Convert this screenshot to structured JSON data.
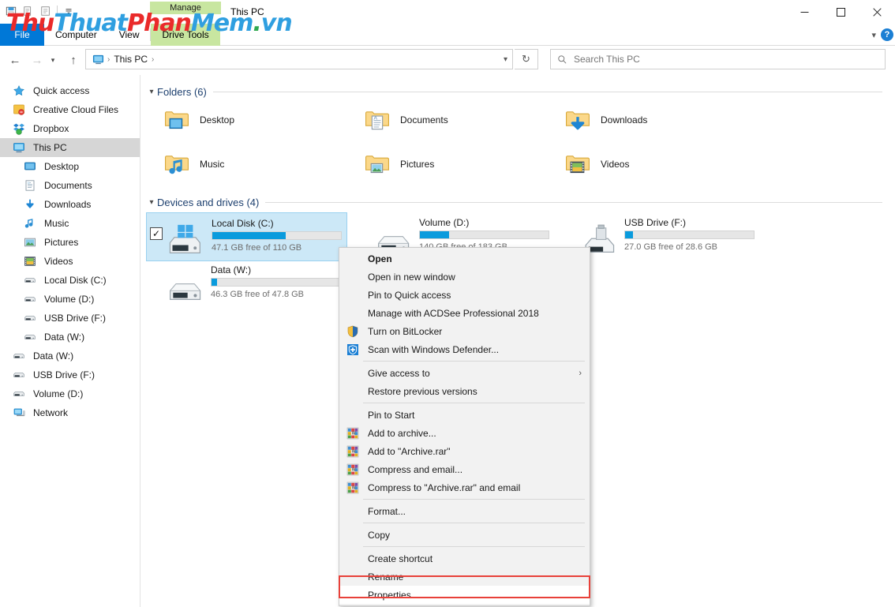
{
  "window": {
    "title": "This PC",
    "minimize_icon": "minimize-icon",
    "maximize_icon": "maximize-icon",
    "close_icon": "close-icon",
    "quick_access_icons": [
      "save-icon",
      "new-folder-icon",
      "properties-icon",
      "customize-icon"
    ]
  },
  "ribbon": {
    "contextual_group": "Manage",
    "tabs": [
      {
        "label": "File",
        "id": "file"
      },
      {
        "label": "Computer",
        "id": "computer"
      },
      {
        "label": "View",
        "id": "view"
      },
      {
        "label": "Drive Tools",
        "id": "drive-tools"
      }
    ],
    "collapse_icon": "chevron-down-icon",
    "help_label": "?"
  },
  "navigation": {
    "back_icon": "arrow-left-icon",
    "forward_icon": "arrow-right-icon",
    "recent_icon": "chevron-down-icon",
    "up_icon": "arrow-up-icon",
    "breadcrumb_icon": "this-pc-icon",
    "breadcrumb": [
      "This PC"
    ],
    "breadcrumb_dropdown_icon": "chevron-down-icon",
    "refresh_icon": "refresh-icon",
    "refresh_label": "↻"
  },
  "search": {
    "icon": "search-icon",
    "placeholder": "Search This PC",
    "value": ""
  },
  "sidebar": {
    "items": [
      {
        "label": "Quick access",
        "icon": "star-icon",
        "level": 0,
        "selected": false
      },
      {
        "label": "Creative Cloud Files",
        "icon": "creative-cloud-icon",
        "level": 0,
        "selected": false
      },
      {
        "label": "Dropbox",
        "icon": "dropbox-icon",
        "level": 0,
        "selected": false
      },
      {
        "label": "This PC",
        "icon": "this-pc-icon",
        "level": 0,
        "selected": true
      },
      {
        "label": "Desktop",
        "icon": "desktop-icon",
        "level": 1,
        "selected": false
      },
      {
        "label": "Documents",
        "icon": "documents-icon",
        "level": 1,
        "selected": false
      },
      {
        "label": "Downloads",
        "icon": "downloads-icon",
        "level": 1,
        "selected": false
      },
      {
        "label": "Music",
        "icon": "music-icon",
        "level": 1,
        "selected": false
      },
      {
        "label": "Pictures",
        "icon": "pictures-icon",
        "level": 1,
        "selected": false
      },
      {
        "label": "Videos",
        "icon": "videos-icon",
        "level": 1,
        "selected": false
      },
      {
        "label": "Local Disk (C:)",
        "icon": "drive-icon",
        "level": 1,
        "selected": false
      },
      {
        "label": "Volume (D:)",
        "icon": "drive-icon",
        "level": 1,
        "selected": false
      },
      {
        "label": "USB Drive (F:)",
        "icon": "drive-icon",
        "level": 1,
        "selected": false
      },
      {
        "label": "Data (W:)",
        "icon": "drive-icon",
        "level": 1,
        "selected": false
      },
      {
        "label": "Data (W:)",
        "icon": "drive-icon",
        "level": 0,
        "selected": false
      },
      {
        "label": "USB Drive (F:)",
        "icon": "drive-icon",
        "level": 0,
        "selected": false
      },
      {
        "label": "Volume (D:)",
        "icon": "drive-icon",
        "level": 0,
        "selected": false
      },
      {
        "label": "Network",
        "icon": "network-icon",
        "level": 0,
        "selected": false
      }
    ]
  },
  "main": {
    "folders_group": {
      "title": "Folders (6)",
      "collapse_icon": "chevron-down-icon",
      "items": [
        {
          "label": "Desktop",
          "icon": "folder-desktop-icon"
        },
        {
          "label": "Documents",
          "icon": "folder-documents-icon"
        },
        {
          "label": "Downloads",
          "icon": "folder-downloads-icon"
        },
        {
          "label": "Music",
          "icon": "folder-music-icon"
        },
        {
          "label": "Pictures",
          "icon": "folder-pictures-icon"
        },
        {
          "label": "Videos",
          "icon": "folder-videos-icon"
        }
      ]
    },
    "drives_group": {
      "title": "Devices and drives (4)",
      "collapse_icon": "chevron-down-icon",
      "items": [
        {
          "name": "Local Disk (C:)",
          "free_text": "47.1 GB free of 110 GB",
          "free_gb": 47.1,
          "total_gb": 110,
          "used_percent": 57,
          "icon": "windows-drive-icon",
          "selected": true,
          "checked": true
        },
        {
          "name": "Volume (D:)",
          "free_text": "140 GB free of 183 GB",
          "free_gb": 140,
          "total_gb": 183,
          "used_percent": 23,
          "icon": "drive-icon",
          "selected": false,
          "checked": false
        },
        {
          "name": "USB Drive (F:)",
          "free_text": "27.0 GB free of 28.6 GB",
          "free_gb": 27.0,
          "total_gb": 28.6,
          "used_percent": 6,
          "icon": "usb-drive-icon",
          "selected": false,
          "checked": false
        },
        {
          "name": "Data (W:)",
          "free_text": "46.3 GB free of 47.8 GB",
          "free_gb": 46.3,
          "total_gb": 47.8,
          "used_percent": 4,
          "icon": "drive-icon",
          "selected": false,
          "checked": false
        }
      ]
    }
  },
  "context_menu": {
    "items": [
      {
        "label": "Open",
        "type": "item",
        "bold": true,
        "icon": null
      },
      {
        "label": "Open in new window",
        "type": "item",
        "icon": null
      },
      {
        "label": "Pin to Quick access",
        "type": "item",
        "icon": null
      },
      {
        "label": "Manage with ACDSee Professional 2018",
        "type": "item",
        "icon": null
      },
      {
        "label": "Turn on BitLocker",
        "type": "item",
        "icon": "bitlocker-shield-icon"
      },
      {
        "label": "Scan with Windows Defender...",
        "type": "item",
        "icon": "defender-shield-icon"
      },
      {
        "type": "separator"
      },
      {
        "label": "Give access to",
        "type": "submenu",
        "icon": null,
        "arrow": "›"
      },
      {
        "label": "Restore previous versions",
        "type": "item",
        "icon": null
      },
      {
        "type": "separator"
      },
      {
        "label": "Pin to Start",
        "type": "item",
        "icon": null
      },
      {
        "label": "Add to archive...",
        "type": "item",
        "icon": "winrar-icon"
      },
      {
        "label": "Add to \"Archive.rar\"",
        "type": "item",
        "icon": "winrar-icon"
      },
      {
        "label": "Compress and email...",
        "type": "item",
        "icon": "winrar-icon"
      },
      {
        "label": "Compress to \"Archive.rar\" and email",
        "type": "item",
        "icon": "winrar-icon"
      },
      {
        "type": "separator"
      },
      {
        "label": "Format...",
        "type": "item",
        "icon": null
      },
      {
        "type": "separator"
      },
      {
        "label": "Copy",
        "type": "item",
        "icon": null
      },
      {
        "type": "separator"
      },
      {
        "label": "Create shortcut",
        "type": "item",
        "icon": null
      },
      {
        "label": "Rename",
        "type": "item",
        "icon": null
      },
      {
        "label": "Properties",
        "type": "item",
        "icon": null,
        "highlighted": true
      }
    ],
    "highlight_color": "#e8413a"
  },
  "watermark": {
    "parts": [
      {
        "text": "Thu",
        "color": "#ea2a2a"
      },
      {
        "text": "Thuat",
        "color": "#2f9fe0"
      },
      {
        "text": "Phan",
        "color": "#ea2a2a"
      },
      {
        "text": "Mem",
        "color": "#2f9fe0"
      },
      {
        "text": ".",
        "color": "#2fa84f"
      },
      {
        "text": "vn",
        "color": "#2f9fe0"
      }
    ]
  },
  "colors": {
    "accent": "#0078d7",
    "selection": "#cce8f7",
    "bar_fill": "#0a9bdd",
    "contextual_tab": "#c8e6a0",
    "group_title": "#1c3f6e"
  }
}
